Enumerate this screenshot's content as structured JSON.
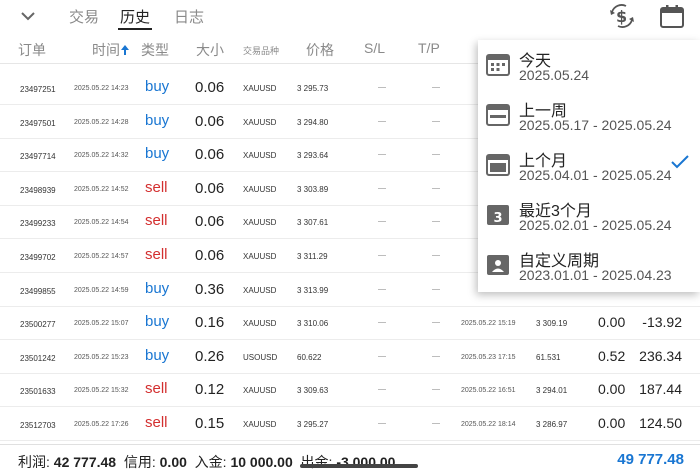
{
  "tabs": [
    {
      "label": "交易",
      "active": false
    },
    {
      "label": "历史",
      "active": true
    },
    {
      "label": "日志",
      "active": false
    }
  ],
  "top_icons": [
    "currency-exchange-icon",
    "calendar-icon"
  ],
  "columns": {
    "id": "订单",
    "time": "时间",
    "type": "类型",
    "volume": "大小",
    "symbol": "交易品种",
    "price": "价格",
    "sl": "S/L",
    "tp": "T/P"
  },
  "rows": [
    {
      "id": "23497251",
      "time": "2025.05.22 14:23",
      "type": "buy",
      "volume": "0.06",
      "symbol": "XAUUSD",
      "price": "3 295.73",
      "close_time": "",
      "close_price": "",
      "swap": "",
      "profit": ""
    },
    {
      "id": "23497501",
      "time": "2025.05.22 14:28",
      "type": "buy",
      "volume": "0.06",
      "symbol": "XAUUSD",
      "price": "3 294.80",
      "close_time": "",
      "close_price": "",
      "swap": "",
      "profit": ""
    },
    {
      "id": "23497714",
      "time": "2025.05.22 14:32",
      "type": "buy",
      "volume": "0.06",
      "symbol": "XAUUSD",
      "price": "3 293.64",
      "close_time": "",
      "close_price": "",
      "swap": "",
      "profit": ""
    },
    {
      "id": "23498939",
      "time": "2025.05.22 14:52",
      "type": "sell",
      "volume": "0.06",
      "symbol": "XAUUSD",
      "price": "3 303.89",
      "close_time": "",
      "close_price": "",
      "swap": "",
      "profit": ""
    },
    {
      "id": "23499233",
      "time": "2025.05.22 14:54",
      "type": "sell",
      "volume": "0.06",
      "symbol": "XAUUSD",
      "price": "3 307.61",
      "close_time": "",
      "close_price": "",
      "swap": "",
      "profit": ""
    },
    {
      "id": "23499702",
      "time": "2025.05.22 14:57",
      "type": "sell",
      "volume": "0.06",
      "symbol": "XAUUSD",
      "price": "3 311.29",
      "close_time": "",
      "close_price": "",
      "swap": "",
      "profit": ""
    },
    {
      "id": "23499855",
      "time": "2025.05.22 14:59",
      "type": "buy",
      "volume": "0.36",
      "symbol": "XAUUSD",
      "price": "3 313.99",
      "close_time": "",
      "close_price": "",
      "swap": "",
      "profit": ""
    },
    {
      "id": "23500277",
      "time": "2025.05.22 15:07",
      "type": "buy",
      "volume": "0.16",
      "symbol": "XAUUSD",
      "price": "3 310.06",
      "close_time": "2025.05.22 15:19",
      "close_price": "3 309.19",
      "swap": "0.00",
      "profit": "-13.92"
    },
    {
      "id": "23501242",
      "time": "2025.05.22 15:23",
      "type": "buy",
      "volume": "0.26",
      "symbol": "USOUSD",
      "price": "60.622",
      "close_time": "2025.05.23 17:15",
      "close_price": "61.531",
      "swap": "0.52",
      "profit": "236.34"
    },
    {
      "id": "23501633",
      "time": "2025.05.22 15:32",
      "type": "sell",
      "volume": "0.12",
      "symbol": "XAUUSD",
      "price": "3 309.63",
      "close_time": "2025.05.22 16:51",
      "close_price": "3 294.01",
      "swap": "0.00",
      "profit": "187.44"
    },
    {
      "id": "23512703",
      "time": "2025.05.22 17:26",
      "type": "sell",
      "volume": "0.15",
      "symbol": "XAUUSD",
      "price": "3 295.27",
      "close_time": "2025.05.22 18:14",
      "close_price": "3 286.97",
      "swap": "0.00",
      "profit": "124.50"
    }
  ],
  "footer": {
    "profit_label": "利润:",
    "profit_value": "42 777.48",
    "credit_label": "信用:",
    "credit_value": "0.00",
    "deposit_label": "入金:",
    "deposit_value": "10 000.00",
    "withdraw_label": "出金:",
    "withdraw_value": "-3 000.00",
    "balance": "49 777.48"
  },
  "period_menu": [
    {
      "title": "今天",
      "range": "2025.05.24",
      "icon": "calendar-icon",
      "checked": false
    },
    {
      "title": "上一周",
      "range": "2025.05.17 - 2025.05.24",
      "icon": "calendar-week-icon",
      "checked": false
    },
    {
      "title": "上个月",
      "range": "2025.04.01 - 2025.05.24",
      "icon": "calendar-month-icon",
      "checked": true
    },
    {
      "title": "最近3个月",
      "range": "2025.02.01 - 2025.05.24",
      "icon": "calendar-3-icon",
      "checked": false
    },
    {
      "title": "自定义周期",
      "range": "2023.01.01 - 2025.04.23",
      "icon": "calendar-custom-icon",
      "checked": false
    }
  ],
  "colors": {
    "buy": "#1976d2",
    "sell": "#d32f2f",
    "accent": "#1976d2"
  }
}
